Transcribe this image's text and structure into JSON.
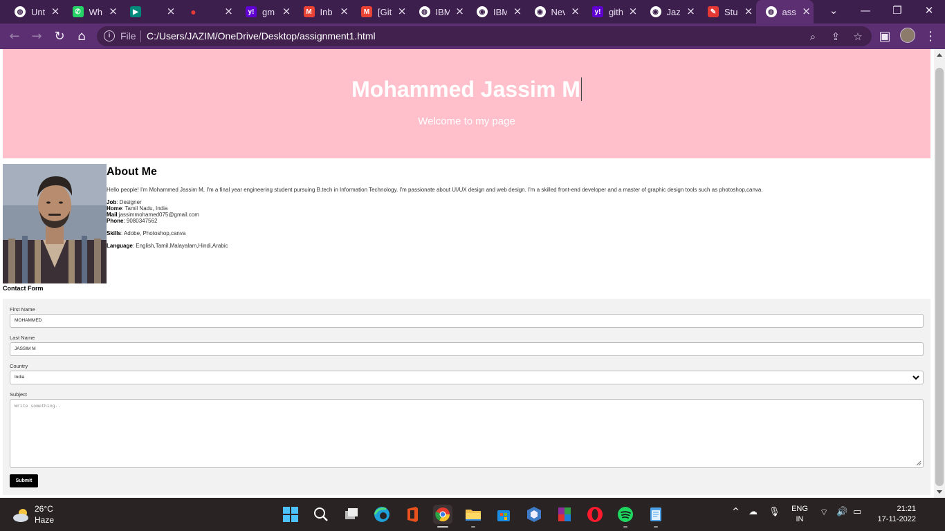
{
  "browser": {
    "tabs": [
      {
        "title": "Unt",
        "icon": "globe-icon",
        "color": "#5c2f72"
      },
      {
        "title": "Wh",
        "icon": "whatsapp-icon",
        "color": "#25d366"
      },
      {
        "title": "",
        "icon": "meet-icon",
        "color": "#00897b"
      },
      {
        "title": "",
        "icon": "record-icon",
        "color": "#e53935"
      },
      {
        "title": "gm",
        "icon": "yahoo-icon",
        "color": "#6001d2"
      },
      {
        "title": "Inb",
        "icon": "gmail-icon",
        "color": "#ea4335"
      },
      {
        "title": "[Git",
        "icon": "gmail-icon",
        "color": "#ea4335"
      },
      {
        "title": "IBM",
        "icon": "globe-icon",
        "color": "#5c2f72"
      },
      {
        "title": "IBM",
        "icon": "github-icon",
        "color": "#ffffff"
      },
      {
        "title": "Nev",
        "icon": "github-icon",
        "color": "#ffffff"
      },
      {
        "title": "gith",
        "icon": "yahoo-icon",
        "color": "#6001d2"
      },
      {
        "title": "Jazi",
        "icon": "github-icon",
        "color": "#ffffff"
      },
      {
        "title": "Stu",
        "icon": "studio-icon",
        "color": "#e53935"
      },
      {
        "title": "assi",
        "icon": "globe-icon",
        "color": "#5c2f72",
        "active": true
      }
    ],
    "address": {
      "scheme_label": "File",
      "url": "C:/Users/JAZIM/OneDrive/Desktop/assignment1.html"
    }
  },
  "page": {
    "header": {
      "name": "Mohammed Jassim M",
      "subtitle": "Welcome to my page",
      "background": "#ffc0cb"
    },
    "about": {
      "heading": "About Me",
      "intro": "Hello people! I'm Mohammed Jassim M, I'm a final year engineering student pursuing B.tech in Information Technology. I'm passionate about UI/UX design and web design. I'm a skilled front-end developer and a master of graphic design tools such as photoshop,canva.",
      "job_label": "Job",
      "job_value": ": Designer",
      "home_label": "Home",
      "home_value": ": Tamil Nadu, India",
      "mail_label": "Mail",
      "mail_value": ":jassimmohamed075@gmail.com",
      "phone_label": "Phone",
      "phone_value": ": 9080347562",
      "skills_label": "Skills",
      "skills_value": ": Adobe, Photoshop,canva",
      "language_label": "Language",
      "language_value": ": English,Tamil,Malayalam,Hindi,Arabic"
    },
    "contact": {
      "title": "Contact Form",
      "first_name_label": "First Name",
      "first_name_value": "MOHAMMED",
      "last_name_label": "Last Name",
      "last_name_value": "JASSIM M",
      "country_label": "Country",
      "country_value": "India",
      "subject_label": "Subject",
      "subject_placeholder": "Write something..",
      "submit_label": "Submit"
    }
  },
  "taskbar": {
    "weather_temp": "26°C",
    "weather_condition": "Haze",
    "lang_line1": "ENG",
    "lang_line2": "IN",
    "time": "21:21",
    "date": "17-11-2022"
  }
}
